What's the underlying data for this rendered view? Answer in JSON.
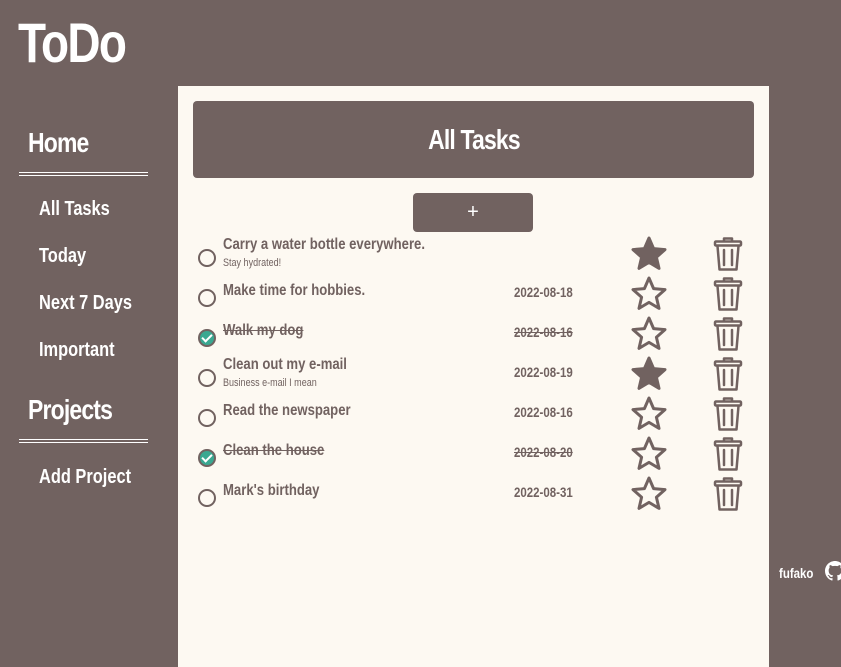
{
  "app": {
    "title": "ToDo"
  },
  "sidebar": {
    "home_heading": "Home",
    "items": [
      {
        "label": "All Tasks"
      },
      {
        "label": "Today"
      },
      {
        "label": "Next 7 Days"
      },
      {
        "label": "Important"
      }
    ],
    "projects_heading": "Projects",
    "add_project_label": "Add Project"
  },
  "main": {
    "header_title": "All Tasks",
    "add_button_label": "+"
  },
  "tasks": [
    {
      "title": "Carry a water bottle everywhere.",
      "description": "Stay hydrated!",
      "date": "",
      "completed": false,
      "important": true
    },
    {
      "title": "Make time for hobbies.",
      "description": "",
      "date": "2022-08-18",
      "completed": false,
      "important": false
    },
    {
      "title": "Walk my dog",
      "description": "",
      "date": "2022-08-16",
      "completed": true,
      "important": false
    },
    {
      "title": "Clean out my e-mail",
      "description": "Business e-mail I mean",
      "date": "2022-08-19",
      "completed": false,
      "important": true
    },
    {
      "title": "Read the newspaper",
      "description": "",
      "date": "2022-08-16",
      "completed": false,
      "important": false
    },
    {
      "title": "Clean the house",
      "description": "",
      "date": "2022-08-20",
      "completed": true,
      "important": false
    },
    {
      "title": "Mark's birthday",
      "description": "",
      "date": "2022-08-31",
      "completed": false,
      "important": false
    }
  ],
  "footer": {
    "author": "fufako",
    "icon": "github-icon"
  },
  "colors": {
    "background": "#716260",
    "panel": "#fdf9f2",
    "check_done": "#3aa891",
    "text": "#ffffff"
  }
}
